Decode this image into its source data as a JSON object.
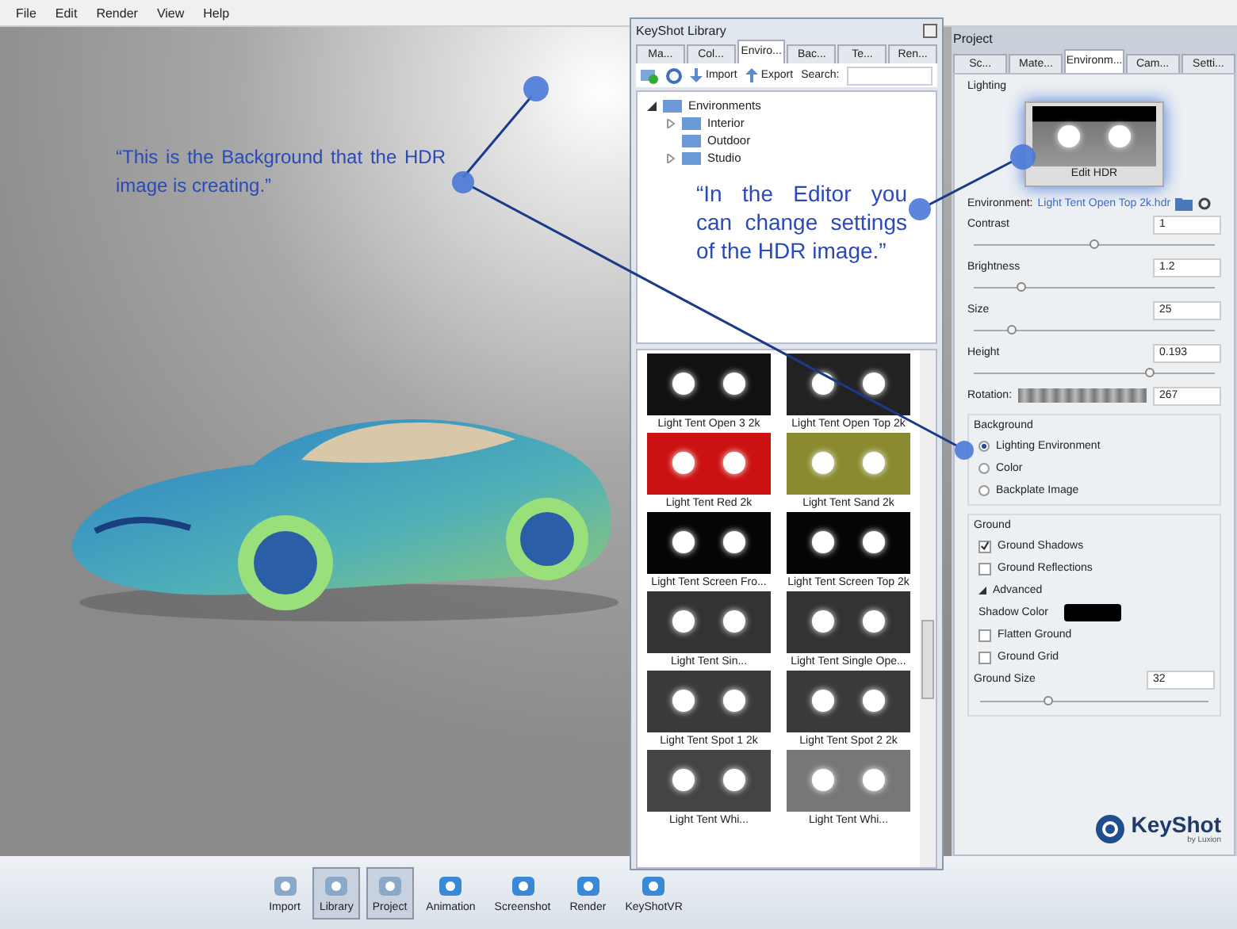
{
  "menu": [
    "File",
    "Edit",
    "Render",
    "View",
    "Help"
  ],
  "viewport": {
    "note": "“This is the Background that the HDR image is creating.”"
  },
  "library": {
    "title": "KeyShot Library",
    "tabs": [
      {
        "label": "Ma...",
        "selected": false
      },
      {
        "label": "Col...",
        "selected": false
      },
      {
        "label": "Enviro...",
        "selected": true
      },
      {
        "label": "Bac...",
        "selected": false
      },
      {
        "label": "Te...",
        "selected": false
      },
      {
        "label": "Ren...",
        "selected": false
      }
    ],
    "toolbar": {
      "import": "Import",
      "export": "Export",
      "search_label": "Search:"
    },
    "tree": [
      {
        "label": "Environments",
        "expanded": true,
        "children": [
          {
            "label": "Interior",
            "expanded": false
          },
          {
            "label": "Outdoor"
          },
          {
            "label": "Studio",
            "expanded": false
          }
        ]
      }
    ],
    "note": "“In the Editor you can change settings of the HDR image.”",
    "thumbnails": [
      {
        "label": "Light Tent Open 3 2k",
        "color": "#111111"
      },
      {
        "label": "Light Tent Open Top 2k",
        "color": "#222222"
      },
      {
        "label": "Light Tent Red 2k",
        "color": "#cc1111"
      },
      {
        "label": "Light Tent Sand 2k",
        "color": "#8a8a30"
      },
      {
        "label": "Light Tent Screen Fro...",
        "color": "#050505"
      },
      {
        "label": "Light Tent Screen Top 2k",
        "color": "#050505"
      },
      {
        "label": "Light Tent Sin...",
        "color": "#333333"
      },
      {
        "label": "Light Tent Single Ope...",
        "color": "#333333"
      },
      {
        "label": "Light Tent Spot 1 2k",
        "color": "#3a3a3a"
      },
      {
        "label": "Light Tent Spot 2 2k",
        "color": "#3a3a3a"
      },
      {
        "label": "Light Tent Whi...",
        "color": "#444444"
      },
      {
        "label": "Light Tent Whi...",
        "color": "#777777"
      }
    ]
  },
  "project": {
    "title": "Project",
    "tabs": [
      {
        "label": "Sc...",
        "selected": false
      },
      {
        "label": "Mate...",
        "selected": false
      },
      {
        "label": "Environm...",
        "selected": true
      },
      {
        "label": "Cam...",
        "selected": false
      },
      {
        "label": "Setti...",
        "selected": false
      }
    ],
    "lighting": {
      "heading": "Lighting",
      "edit_button": "Edit HDR",
      "environment_label": "Environment:",
      "environment_value": "Light Tent Open Top 2k.hdr"
    },
    "controls": [
      {
        "kind": "slider",
        "label": "Contrast",
        "value": "1",
        "level": 0.5
      },
      {
        "kind": "slider",
        "label": "Brightness",
        "value": "1.2",
        "level": 0.2
      },
      {
        "kind": "slider",
        "label": "Size",
        "value": "25",
        "level": 0.16
      },
      {
        "kind": "slider",
        "label": "Height",
        "value": "0.193",
        "level": 0.73
      },
      {
        "kind": "strip",
        "label": "Rotation:",
        "value": "267"
      }
    ],
    "background": {
      "heading": "Background",
      "options": [
        {
          "label": "Lighting Environment",
          "selected": true
        },
        {
          "label": "Color",
          "selected": false
        },
        {
          "label": "Backplate Image",
          "selected": false
        }
      ]
    },
    "ground": {
      "heading": "Ground",
      "checks": [
        {
          "label": "Ground Shadows",
          "checked": true
        },
        {
          "label": "Ground Reflections",
          "checked": false
        }
      ],
      "advanced": {
        "label": "Advanced",
        "expanded": true
      },
      "shadow_color_label": "Shadow Color",
      "advanced_checks": [
        {
          "label": "Flatten Ground",
          "checked": false
        },
        {
          "label": "Ground Grid",
          "checked": false
        }
      ],
      "size": {
        "label": "Ground Size",
        "value": "32",
        "level": 0.3
      }
    },
    "logo": {
      "name": "KeyShot",
      "tagline": "by Luxion"
    }
  },
  "toolbar": [
    {
      "label": "Import",
      "selected": false
    },
    {
      "label": "Library",
      "selected": true
    },
    {
      "label": "Project",
      "selected": true
    },
    {
      "label": "Animation",
      "selected": false
    },
    {
      "label": "Screenshot",
      "selected": false
    },
    {
      "label": "Render",
      "selected": false
    },
    {
      "label": "KeyShotVR",
      "selected": false
    }
  ]
}
